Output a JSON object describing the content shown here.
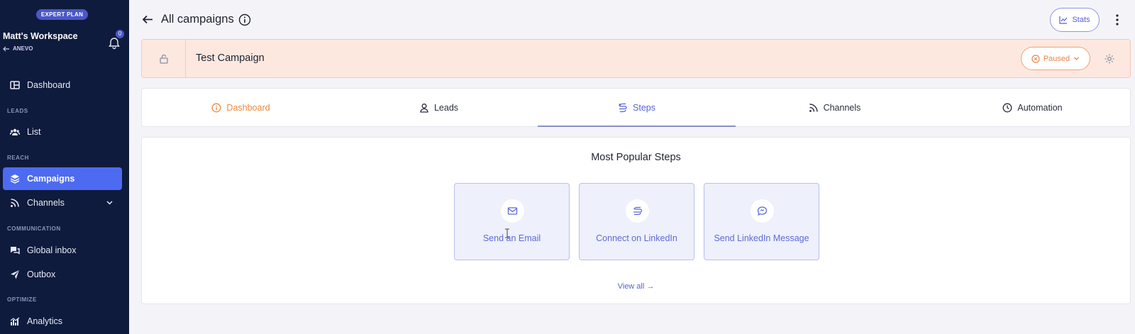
{
  "sidebar": {
    "plan_badge": "EXPERT PLAN",
    "workspace_name": "Matt's Workspace",
    "workspace_sub": "ANEVO",
    "notifications_count": "0",
    "items": {
      "dashboard": "Dashboard",
      "list": "List",
      "campaigns": "Campaigns",
      "channels": "Channels",
      "global_inbox": "Global inbox",
      "outbox": "Outbox",
      "analytics": "Analytics"
    },
    "sections": {
      "leads": "LEADS",
      "reach": "REACH",
      "communication": "COMMUNICATION",
      "optimize": "OPTIMIZE"
    }
  },
  "header": {
    "title": "All campaigns",
    "stats_label": "Stats"
  },
  "campaign": {
    "name": "Test Campaign",
    "status": "Paused"
  },
  "tabs": {
    "dashboard": "Dashboard",
    "leads": "Leads",
    "steps": "Steps",
    "channels": "Channels",
    "automation": "Automation"
  },
  "main": {
    "title": "Most Popular Steps",
    "steps": [
      {
        "label": "Send an Email",
        "icon": "mail-icon"
      },
      {
        "label": "Connect on LinkedIn",
        "icon": "connect-icon"
      },
      {
        "label": "Send LinkedIn Message",
        "icon": "message-icon"
      }
    ],
    "view_all": "View all →"
  },
  "colors": {
    "sidebar_bg": "#0f1b3d",
    "accent": "#4d6bf0",
    "paused": "#e8874a",
    "campaign_bar_bg": "#fde8e0"
  }
}
